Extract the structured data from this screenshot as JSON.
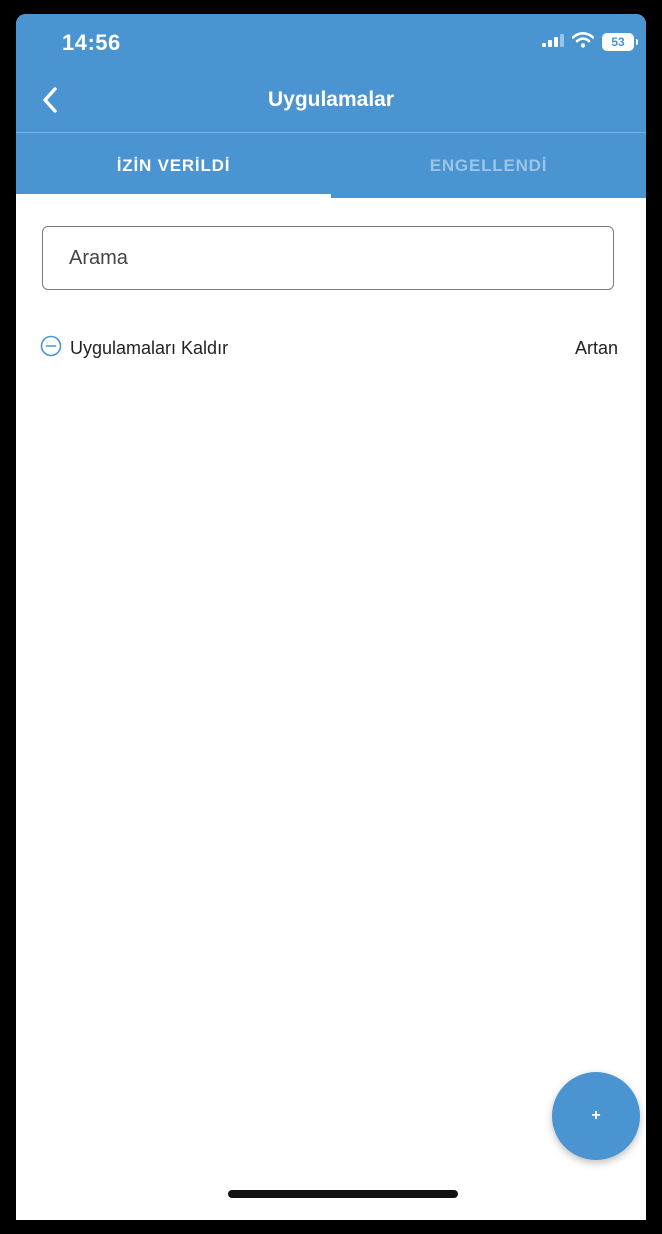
{
  "status_bar": {
    "time": "14:56",
    "battery": "53"
  },
  "navbar": {
    "title": "Uygulamalar"
  },
  "tabs": [
    {
      "label": "İZİN VERİLDİ",
      "active": true
    },
    {
      "label": "ENGELLENDİ",
      "active": false
    }
  ],
  "search": {
    "placeholder": "Arama",
    "value": ""
  },
  "actions": {
    "remove_label": "Uygulamaları Kaldır",
    "sort_label": "Artan"
  },
  "fab": {
    "label": "+"
  },
  "colors": {
    "accent": "#4a94d1",
    "background": "#ffffff"
  },
  "icons": {
    "back": "chevron-left-icon",
    "signal": "cellular-signal-icon",
    "wifi": "wifi-icon",
    "battery": "battery-icon",
    "remove": "minus-circle-icon"
  }
}
